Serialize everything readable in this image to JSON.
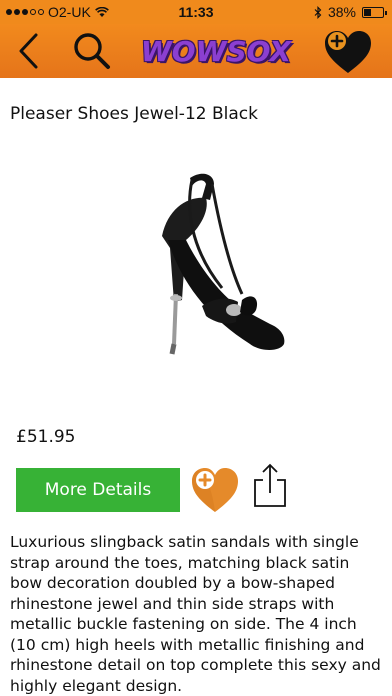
{
  "status_bar": {
    "carrier": "O2-UK",
    "time": "11:33",
    "battery_percent": "38%",
    "battery_level": 0.38,
    "signal_icon": "signal-dots-icon",
    "wifi_icon": "wifi-icon",
    "bluetooth_icon": "bluetooth-icon"
  },
  "header": {
    "logo_text": "WOWSOX",
    "back_icon": "chevron-left-icon",
    "search_icon": "search-icon",
    "favourites_icon": "heart-plus-icon"
  },
  "product": {
    "title": "Pleaser Shoes Jewel-12 Black",
    "price": "£51.95",
    "more_details_label": "More Details",
    "description": "Luxurious slingback satin sandals with single strap around the toes, matching black satin bow decoration doubled by a bow-shaped rhinestone jewel and thin side straps with metallic buckle fastening on side. The 4 inch (10 cm) high heels with metallic finishing and rhinestone detail on top complete this sexy and highly elegant design."
  },
  "colors": {
    "header_orange": "#f08a1c",
    "logo_purple": "#8b3fd1",
    "button_green": "#37b236",
    "heart_orange": "#e58a2a"
  }
}
